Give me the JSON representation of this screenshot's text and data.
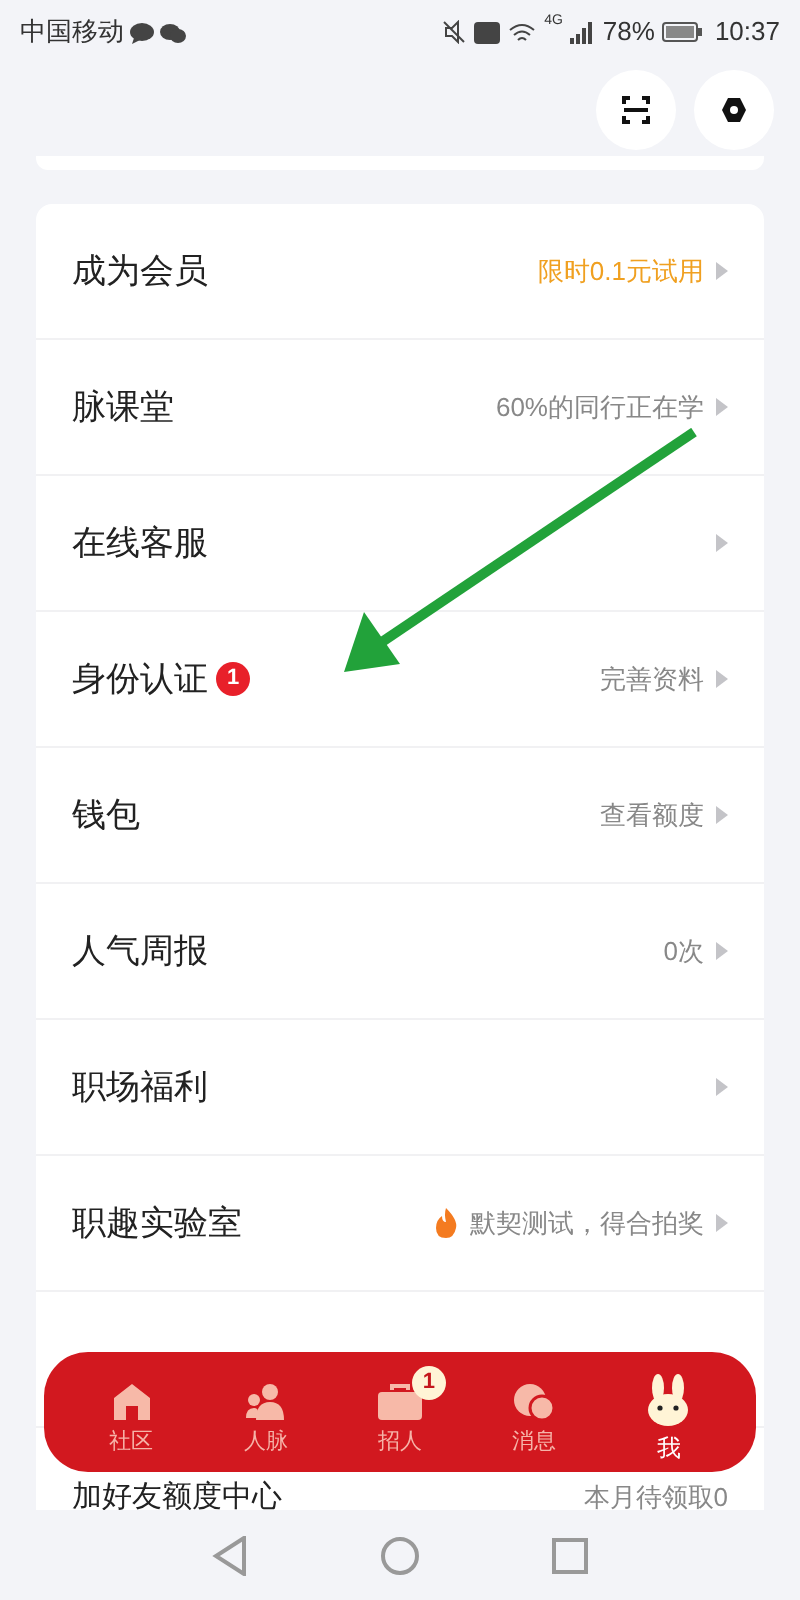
{
  "status_bar": {
    "carrier": "中国移动",
    "signal_label": "4G",
    "battery": "78%",
    "time": "10:37"
  },
  "menu": [
    {
      "label": "成为会员",
      "value": "限时0.1元试用",
      "highlight": true,
      "fire": false
    },
    {
      "label": "脉课堂",
      "value": "60%的同行正在学",
      "highlight": false,
      "fire": false
    },
    {
      "label": "在线客服",
      "fire": false
    },
    {
      "label": "身份认证",
      "value": "完善资料",
      "highlight": false,
      "badge": "1",
      "fire": false
    },
    {
      "label": "钱包",
      "value": "查看额度",
      "highlight": false,
      "fire": false
    },
    {
      "label": "人气周报",
      "value": "0次",
      "highlight": false,
      "fire": false
    },
    {
      "label": "职场福利",
      "fire": false
    },
    {
      "label": "职趣实验室",
      "value": "默契测试，得合拍奖",
      "highlight": false,
      "fire": true
    }
  ],
  "last_item": {
    "label": "加好友额度中心",
    "value": "本月待领取0"
  },
  "tab_bar": [
    {
      "label": "社区",
      "kind": "home",
      "selected": false
    },
    {
      "label": "人脉",
      "kind": "people",
      "selected": false
    },
    {
      "label": "招人",
      "kind": "briefcase",
      "selected": false,
      "badge": "1"
    },
    {
      "label": "消息",
      "kind": "chat",
      "selected": false
    },
    {
      "label": "我",
      "kind": "rabbit",
      "selected": true
    }
  ]
}
